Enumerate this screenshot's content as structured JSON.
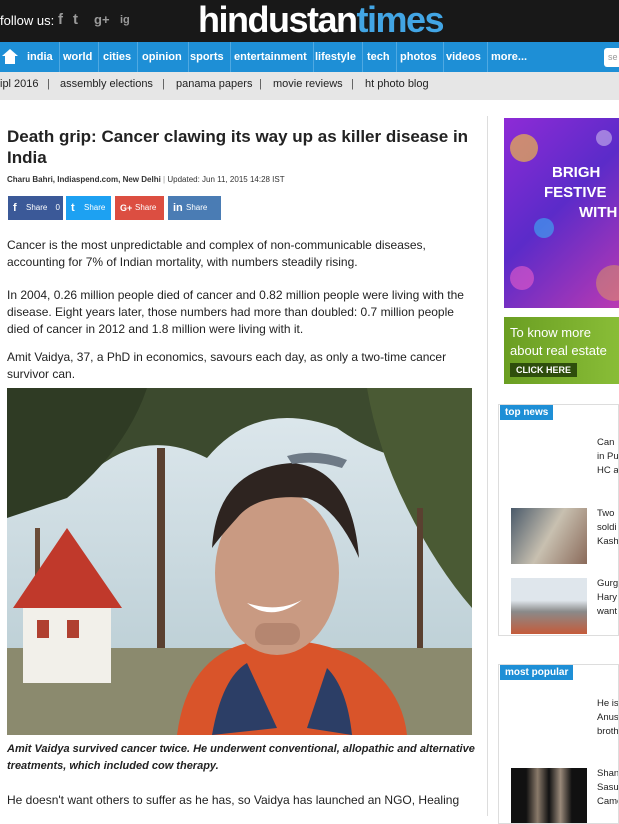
{
  "topbar": {
    "follow_label": "follow us:",
    "social": [
      "f",
      "t",
      "g+",
      "ig"
    ],
    "logo_part1": "hindustan",
    "logo_part2": "times"
  },
  "nav": {
    "items": [
      "india",
      "world",
      "cities",
      "opinion",
      "sports",
      "entertainment",
      "lifestyle",
      "tech",
      "photos",
      "videos",
      "more..."
    ],
    "search_placeholder": "se"
  },
  "subnav": {
    "items": [
      "ipl 2016",
      "assembly elections",
      "panama papers",
      "movie reviews",
      "ht photo blog"
    ],
    "separator": "|"
  },
  "article": {
    "title": "Death grip: Cancer clawing its way up as killer disease in India",
    "author": "Charu Bahri, Indiaspend.com, New Delhi",
    "updated": "Updated: Jun 11, 2015 14:28 IST",
    "share": {
      "facebook": {
        "label": "Share",
        "count": "0",
        "icon": "f"
      },
      "twitter": {
        "label": "Share",
        "icon": "t"
      },
      "google": {
        "label": "Share",
        "icon": "G+"
      },
      "linkedin": {
        "label": "Share",
        "icon": "in"
      }
    },
    "paragraphs": [
      "Cancer is the most unpredictable and complex of non-communicable diseases, accounting for 7% of Indian mortality, with numbers steadily rising.",
      "In 2004, 0.26 million people died of cancer and 0.82 million people were living with the disease. Eight years later, those numbers had more than doubled: 0.7 million people died of cancer in 2012 and 1.8 million were living with it.",
      "Amit Vaidya, 37, a PhD in economics, savours each day, as only a two-time cancer survivor can.",
      "He doesn't want others to suffer as he has, so Vaidya has launched an NGO, Healing"
    ],
    "caption": "Amit Vaidya survived cancer twice. He underwent conventional, allopathic and alternative treatments, which included cow therapy."
  },
  "sidebar": {
    "ad1_lines": [
      "BRIGH",
      "FESTIVE",
      "WITH"
    ],
    "ad2_lines": [
      "To know more",
      "about real estate"
    ],
    "ad2_cta": "CLICK HERE",
    "top_news": {
      "heading": "top news",
      "items": [
        [
          "Can I",
          "in Pu",
          "HC a"
        ],
        [
          "Two",
          "soldi",
          "Kash"
        ],
        [
          "Gurg",
          "Hary",
          "want"
        ]
      ]
    },
    "most_popular": {
      "heading": "most popular",
      "items": [
        [
          "He is",
          "Anus",
          "broth"
        ],
        [
          "Shan",
          "Sasu",
          "Came"
        ]
      ]
    }
  }
}
